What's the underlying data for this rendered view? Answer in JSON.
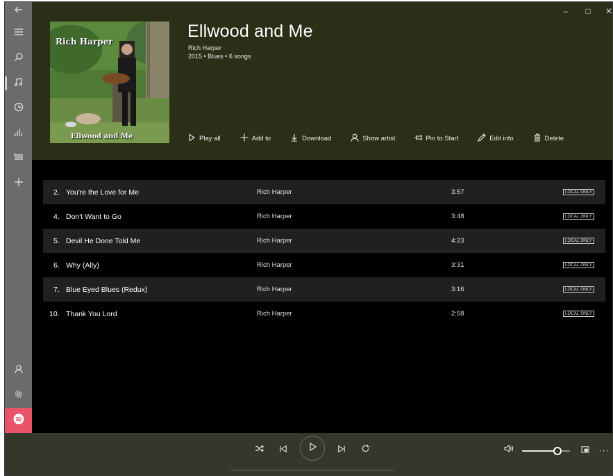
{
  "window": {
    "caption_minimize": "–",
    "caption_maximize": "□",
    "caption_close": "✕"
  },
  "rail": {
    "items": [
      {
        "icon": "back-arrow-icon"
      },
      {
        "icon": "hamburger-menu-icon"
      },
      {
        "icon": "search-icon"
      },
      {
        "icon": "music-note-icon",
        "active": true
      },
      {
        "icon": "recent-clock-icon"
      },
      {
        "icon": "now-playing-bars-icon"
      },
      {
        "icon": "playlists-icon"
      },
      {
        "icon": "add-icon"
      },
      {
        "icon": "account-person-icon"
      },
      {
        "icon": "settings-gear-icon"
      },
      {
        "icon": "spotify-icon"
      }
    ]
  },
  "album": {
    "art_top_text": "Rich Harper",
    "art_bottom_text": "Ellwood and Me",
    "title": "Ellwood and Me",
    "artist": "Rich Harper",
    "meta": "2015 • Blues • 6 songs"
  },
  "actions": {
    "play_all": "Play all",
    "add_to": "Add to",
    "download": "Download",
    "show_artist": "Show artist",
    "pin_to_start": "Pin to Start",
    "edit_info": "Edit info",
    "delete": "Delete"
  },
  "songs": [
    {
      "num": "2.",
      "title": "You're the Love for Me",
      "artist": "Rich Harper",
      "duration": "3:57",
      "badge": "LOCAL ONLY"
    },
    {
      "num": "4.",
      "title": "Don't Want to Go",
      "artist": "Rich Harper",
      "duration": "3:48",
      "badge": "LOCAL ONLY"
    },
    {
      "num": "5.",
      "title": "Devil He Done Told Me",
      "artist": "Rich Harper",
      "duration": "4:23",
      "badge": "LOCAL ONLY"
    },
    {
      "num": "6.",
      "title": "Why (Ally)",
      "artist": "Rich Harper",
      "duration": "3:31",
      "badge": "LOCAL ONLY"
    },
    {
      "num": "7.",
      "title": "Blue Eyed Blues (Redux)",
      "artist": "Rich Harper",
      "duration": "3:16",
      "badge": "LOCAL ONLY"
    },
    {
      "num": "10.",
      "title": "Thank You Lord",
      "artist": "Rich Harper",
      "duration": "2:58",
      "badge": "LOCAL ONLY"
    }
  ],
  "player": {
    "volume_level": 0.8,
    "progress": 0.0,
    "colors": {
      "header_bg": "#2b2f17",
      "player_bg": "#34382a",
      "spotify": "#e9546a"
    }
  }
}
